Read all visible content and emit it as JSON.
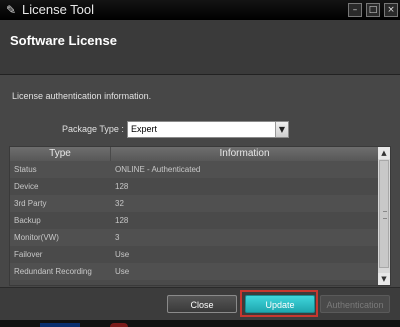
{
  "window": {
    "title": "License Tool",
    "minimize_icon": "minimize-icon",
    "maximize_icon": "maximize-icon",
    "close_icon": "close-icon"
  },
  "header": {
    "title": "Software License"
  },
  "content": {
    "info_text": "License authentication information.",
    "package_type_label": "Package Type :",
    "package_type_value": "Expert"
  },
  "table": {
    "columns": [
      "Type",
      "Information"
    ],
    "rows": [
      {
        "type": "Status",
        "info": "ONLINE - Authenticated"
      },
      {
        "type": "Device",
        "info": "128"
      },
      {
        "type": "3rd Party",
        "info": "32"
      },
      {
        "type": "Backup",
        "info": "128"
      },
      {
        "type": "Monitor(VW)",
        "info": "3"
      },
      {
        "type": "Failover",
        "info": "Use"
      },
      {
        "type": "Redundant Recording",
        "info": "Use"
      }
    ]
  },
  "footer": {
    "close_label": "Close",
    "update_label": "Update",
    "authentication_label": "Authentication"
  },
  "colors": {
    "accent": "#2ab8c0",
    "highlight": "#c7372f"
  }
}
